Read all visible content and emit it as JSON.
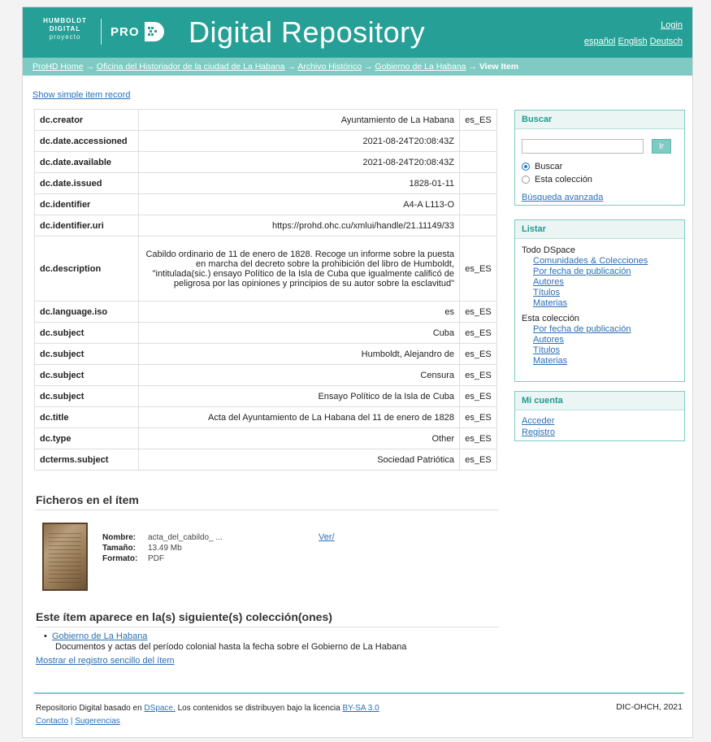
{
  "header": {
    "logo_line1": "HUMBOLDT",
    "logo_line2": "DIGITAL",
    "logo_line3": "proyecto",
    "pro_label": "PRO",
    "pro_icon": "prohd-hd-icon",
    "title": "Digital Repository",
    "login": "Login",
    "languages": [
      "español",
      "English",
      "Deutsch"
    ],
    "colors": {
      "header_bg": "#26a096",
      "breadcrumb_bg": "#7fcac3",
      "link": "#2a6fb5"
    }
  },
  "breadcrumb": {
    "items": [
      "ProHD Home",
      "Oficina del Historiador de la ciudad de La Habana",
      "Archivo Histórico",
      "Gobierno de La Habana"
    ],
    "separator": "→",
    "current": "View Item"
  },
  "main": {
    "show_simple_link": "Show simple item record",
    "metadata": [
      {
        "key": "dc.creator",
        "value": "Ayuntamiento de La Habana",
        "lang": "es_ES"
      },
      {
        "key": "dc.date.accessioned",
        "value": "2021-08-24T20:08:43Z",
        "lang": ""
      },
      {
        "key": "dc.date.available",
        "value": "2021-08-24T20:08:43Z",
        "lang": ""
      },
      {
        "key": "dc.date.issued",
        "value": "1828-01-11",
        "lang": ""
      },
      {
        "key": "dc.identifier",
        "value": "A4-A L113-O",
        "lang": ""
      },
      {
        "key": "dc.identifier.uri",
        "value": "https://prohd.ohc.cu/xmlui/handle/21.11149/33",
        "lang": ""
      },
      {
        "key": "dc.description",
        "value": "Cabildo ordinario de 11 de enero de 1828. Recoge un informe sobre la puesta en marcha del decreto sobre la prohibición del libro de Humboldt, \"intitulada(sic.) ensayo Político de la Isla de Cuba que igualmente calificó de peligrosa por las opiniones y principios de su autor sobre la esclavitud\"",
        "lang": "es_ES"
      },
      {
        "key": "dc.language.iso",
        "value": "es",
        "lang": "es_ES"
      },
      {
        "key": "dc.subject",
        "value": "Cuba",
        "lang": "es_ES"
      },
      {
        "key": "dc.subject",
        "value": "Humboldt, Alejandro de",
        "lang": "es_ES"
      },
      {
        "key": "dc.subject",
        "value": "Censura",
        "lang": "es_ES"
      },
      {
        "key": "dc.subject",
        "value": "Ensayo Político de la Isla de Cuba",
        "lang": "es_ES"
      },
      {
        "key": "dc.title",
        "value": "Acta del Ayuntamiento de La Habana del 11 de enero de 1828",
        "lang": "es_ES"
      },
      {
        "key": "dc.type",
        "value": "Other",
        "lang": "es_ES"
      },
      {
        "key": "dcterms.subject",
        "value": "Sociedad Patriótica",
        "lang": "es_ES"
      }
    ],
    "files": {
      "title": "Ficheros en el ítem",
      "name_label": "Nombre:",
      "name": "acta_del_cabildo_ ...",
      "size_label": "Tamaño:",
      "size": "13.49 Mb",
      "format_label": "Formato:",
      "format": "PDF",
      "view": "Ver/"
    },
    "collections": {
      "title": "Este ítem aparece en la(s) siguiente(s) colección(ones)",
      "items": [
        {
          "name": "Gobierno de La Habana",
          "description": "Documentos y actas del período colonial hasta la fecha sobre el Gobierno de La Habana"
        }
      ],
      "show_simple": "Mostrar el registro sencillo del ítem"
    }
  },
  "sidebar": {
    "search": {
      "title": "Buscar",
      "input_value": "",
      "go_label": "Ir",
      "scope_options": [
        "Buscar",
        "Esta colección"
      ],
      "selected_scope": "Buscar",
      "advanced": "Búsqueda avanzada"
    },
    "browse": {
      "title": "Listar",
      "all_title": "Todo DSpace",
      "all_items": [
        "Comunidades & Colecciones",
        "Por fecha de publicación",
        "Autores",
        "Títulos",
        "Materias"
      ],
      "coll_title": "Esta colección",
      "coll_items": [
        "Por fecha de publicación",
        "Autores",
        "Títulos",
        "Materias"
      ]
    },
    "account": {
      "title": "Mi cuenta",
      "items": [
        "Acceder",
        "Registro"
      ]
    }
  },
  "footer": {
    "prefix": "Repositorio Digital basado en",
    "dspace": "DSpace.",
    "middle": "Los contenidos se distribuyen bajo la licencia",
    "license": "BY-SA 3.0",
    "contact": "Contacto",
    "separator": "|",
    "feedback": "Sugerencias",
    "right": "DIC-OHCH, 2021"
  }
}
